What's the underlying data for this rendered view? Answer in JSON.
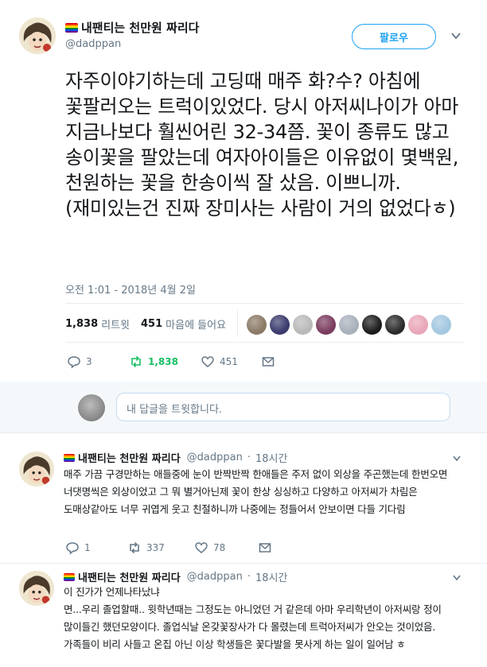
{
  "main_tweet": {
    "display_name": "내팬티는 천만원 짜리다",
    "handle": "@dadppan",
    "follow_label": "팔로우",
    "text": "자주이야기하는데 고딩때 매주 화?수? 아침에 꽃팔러오는 트럭이있었다. 당시 아저씨나이가 아마 지금나보다 훨씬어린 32-34쯤. 꽃이 종류도 많고 송이꽃을 팔았는데 여자아이들은 이유없이 몇백원, 천원하는 꽃을 한송이씩 잘 샀음. 이쁘니까.(재미있는건 진짜 장미사는 사람이 거의 없었다ㅎ)",
    "timestamp": "오전 1:01 - 2018년 4월 2일",
    "retweet_count": "1,838",
    "retweet_label": "리트윗",
    "like_count": "451",
    "like_label": "마음에 들어요",
    "liker_colors": [
      "#8a7a66",
      "#3b3b6e",
      "#b9b9b9",
      "#7a3b5e",
      "#a8b0bb",
      "#1c1c1c",
      "#2b2b2b",
      "#e9a6b8",
      "#a3c7e0"
    ],
    "actions": {
      "reply_count": "3",
      "retweet_count": "1,838",
      "like_count": "451"
    }
  },
  "reply_box": {
    "placeholder": "내 답글을 트윗합니다."
  },
  "replies": [
    {
      "display_name": "내팬티는 천만원 짜리다",
      "handle": "@dadppan",
      "separator": "·",
      "time": "18시간",
      "text": "매주 가끔 구경만하는 애들중에 눈이 반짝반짝 한애들은 주저 없이 외상을 주곤했는데 한번오면 너댓명씩은 외상이었고 그 뭐 별거아닌제 꽃이 한상 싱싱하고 다양하고 아저씨가 차림은 도매상같아도 너무 귀엽게 웃고 친절하니까 나중에는 정들어서 안보이면 다들 기다림",
      "reply_count": "1",
      "retweet_count": "337",
      "like_count": "78"
    },
    {
      "display_name": "내팬티는 천만원 짜리다",
      "handle": "@dadppan",
      "separator": "·",
      "time": "18시간",
      "line1": "이 진가가 언제나타났냐",
      "text": "면...우리 졸업할때.. 윗학년때는 그정도는 아니었던 거 같은데 아마 우리학년이 아저씨랑 정이 많이들긴 했던모양이다. 졸업식날 온갖꽃장사가 다 몰렸는데 트럭아저씨가 안오는 것이었음. 가족들이 비리 사들고 온집 아닌 이상 학생들은 꽃다발을 못사게 하는 일이 일어남 ㅎ"
    }
  ]
}
